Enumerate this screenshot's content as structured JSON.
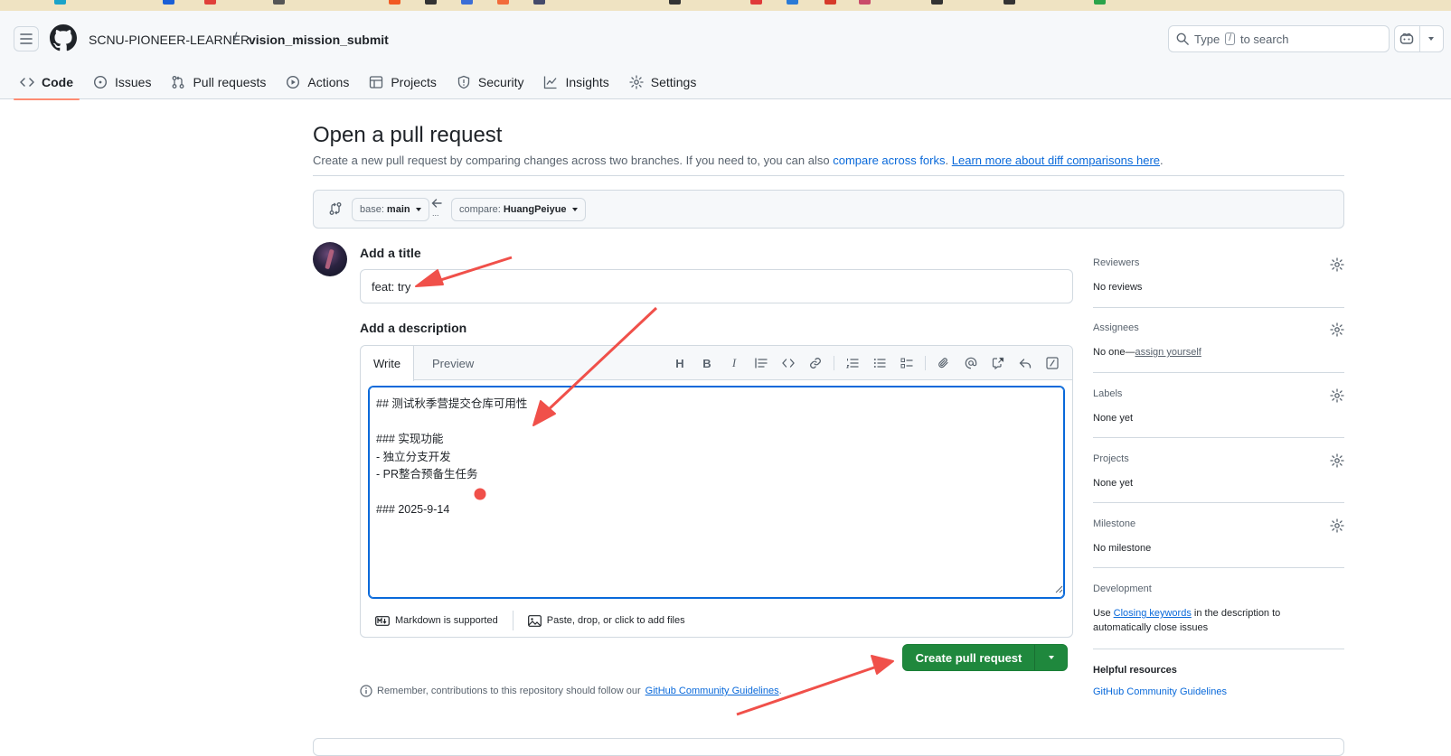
{
  "header": {
    "owner": "SCNU-PIONEER-LEARNER",
    "separator": "/",
    "repo": "vision_mission_submit",
    "search_prefix": "Type",
    "search_key": "/",
    "search_suffix": "to search"
  },
  "nav": {
    "tabs": [
      {
        "label": "Code",
        "icon": "code-icon",
        "active": true
      },
      {
        "label": "Issues",
        "icon": "issue-opened-icon"
      },
      {
        "label": "Pull requests",
        "icon": "git-pull-request-icon"
      },
      {
        "label": "Actions",
        "icon": "play-icon"
      },
      {
        "label": "Projects",
        "icon": "table-icon"
      },
      {
        "label": "Security",
        "icon": "shield-icon"
      },
      {
        "label": "Insights",
        "icon": "graph-icon"
      },
      {
        "label": "Settings",
        "icon": "gear-icon"
      }
    ]
  },
  "page": {
    "title": "Open a pull request",
    "subtitle_text": "Create a new pull request by comparing changes across two branches. If you need to, you can also",
    "subtitle_link1": "compare across forks",
    "subtitle_link2": "Learn more about diff comparisons here",
    "subtitle_end": "."
  },
  "branches": {
    "base_prefix": "base:",
    "base_name": "main",
    "compare_prefix": "compare:",
    "compare_name": "HuangPeiyue",
    "dots": "..."
  },
  "form": {
    "title_label": "Add a title",
    "title_value": "feat: try",
    "description_label": "Add a description",
    "tab_write": "Write",
    "tab_preview": "Preview",
    "description_value": "## 测试秋季营提交仓库可用性\n\n### 实现功能\n- 独立分支开发\n- PR整合预备生任务\n\n### 2025-9-14",
    "markdown_note": "Markdown is supported",
    "attach_note": "Paste, drop, or click to add files",
    "toolbar_heading": "H",
    "toolbar_bold": "B",
    "toolbar_italic": "I"
  },
  "actions": {
    "create_label": "Create pull request"
  },
  "reminder": {
    "text": "Remember, contributions to this repository should follow our",
    "link": "GitHub Community Guidelines",
    "end": "."
  },
  "sidebar": {
    "reviewers_h": "Reviewers",
    "reviewers_v": "No reviews",
    "assignees_h": "Assignees",
    "assignees_v": "No one—",
    "assignees_link": "assign yourself",
    "labels_h": "Labels",
    "labels_v": "None yet",
    "projects_h": "Projects",
    "projects_v": "None yet",
    "milestone_h": "Milestone",
    "milestone_v": "No milestone",
    "development_h": "Development",
    "development_pre": "Use",
    "development_link": "Closing keywords",
    "development_post": "in the description to automatically close issues",
    "helpful_h": "Helpful resources",
    "helpful_link": "GitHub Community Guidelines"
  },
  "colors": {
    "accent_blue": "#0969da",
    "primary_green": "#1f883d",
    "active_tab_underline": "#fd8c73",
    "annotation_red": "#f0504a"
  }
}
